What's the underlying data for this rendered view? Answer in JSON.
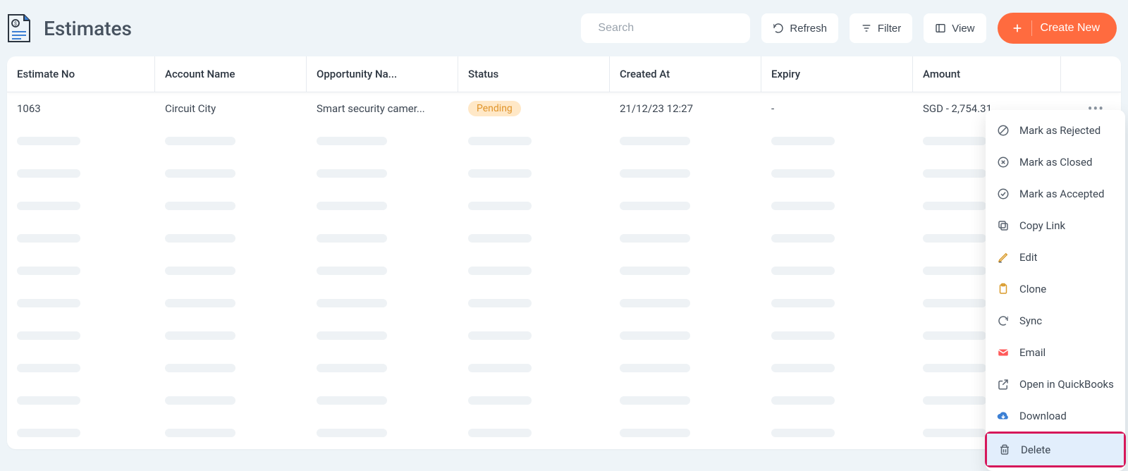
{
  "header": {
    "title": "Estimates",
    "search_placeholder": "Search",
    "refresh_label": "Refresh",
    "filter_label": "Filter",
    "view_label": "View",
    "create_label": "Create New"
  },
  "columns": {
    "estimate_no": "Estimate No",
    "account_name": "Account Name",
    "opportunity": "Opportunity Na...",
    "status": "Status",
    "created_at": "Created At",
    "expiry": "Expiry",
    "amount": "Amount"
  },
  "row": {
    "estimate_no": "1063",
    "account_name": "Circuit City",
    "opportunity": "Smart security camer...",
    "status": "Pending",
    "created_at": "21/12/23 12:27",
    "expiry": "-",
    "amount": "SGD - 2,754.31"
  },
  "status_colors": {
    "pending_bg": "#ffe8c7",
    "pending_fg": "#e0942a"
  },
  "menu": {
    "mark_rejected": "Mark as Rejected",
    "mark_closed": "Mark as Closed",
    "mark_accepted": "Mark as Accepted",
    "copy_link": "Copy Link",
    "edit": "Edit",
    "clone": "Clone",
    "sync": "Sync",
    "email": "Email",
    "open_quickbooks": "Open in QuickBooks",
    "download": "Download",
    "delete": "Delete"
  }
}
